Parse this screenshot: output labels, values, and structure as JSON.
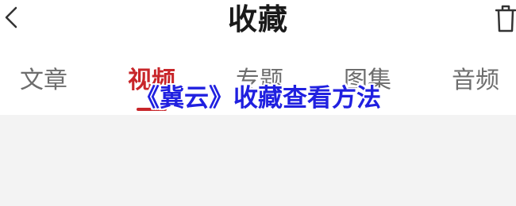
{
  "header": {
    "title": "收藏",
    "back_icon": "chevron-left-icon",
    "trash_icon": "trash-icon"
  },
  "tabs": [
    {
      "label": "文章",
      "active": false
    },
    {
      "label": "视频",
      "active": true
    },
    {
      "label": "专题",
      "active": false
    },
    {
      "label": "图集",
      "active": false
    },
    {
      "label": "音频",
      "active": false
    }
  ],
  "overlay": {
    "caption": "《冀云》收藏查看方法"
  },
  "colors": {
    "accent": "#c8262a",
    "caption": "#2020e0",
    "tab_inactive": "#6d6d6d",
    "content_bg": "#f3f3f3"
  }
}
